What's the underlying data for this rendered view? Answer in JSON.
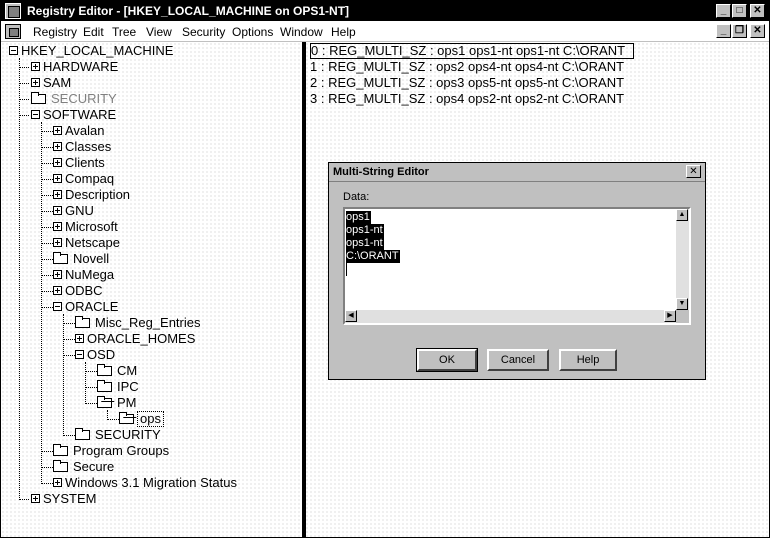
{
  "window": {
    "title": "Registry Editor - [HKEY_LOCAL_MACHINE on OPS1-NT]",
    "controls": {
      "minimize": "_",
      "maximize": "□",
      "close": "✕"
    }
  },
  "menu": {
    "items": [
      "Registry",
      "Edit",
      "Tree",
      "View",
      "Security",
      "Options",
      "Window",
      "Help"
    ],
    "doc_controls": {
      "minimize": "_",
      "restore": "❐",
      "close": "✕"
    }
  },
  "tree": {
    "nodes": [
      {
        "label": "HKEY_LOCAL_MACHINE",
        "expanded": true
      },
      {
        "label": "HARDWARE",
        "expanded": false
      },
      {
        "label": "SAM",
        "expanded": false
      },
      {
        "label": "SECURITY",
        "expanded": false,
        "disabled": true
      },
      {
        "label": "SOFTWARE",
        "expanded": true
      },
      {
        "label": "Avalan",
        "expanded": false
      },
      {
        "label": "Classes",
        "expanded": false
      },
      {
        "label": "Clients",
        "expanded": false
      },
      {
        "label": "Compaq",
        "expanded": false
      },
      {
        "label": "Description",
        "expanded": false
      },
      {
        "label": "GNU",
        "expanded": false
      },
      {
        "label": "Microsoft",
        "expanded": false
      },
      {
        "label": "Netscape",
        "expanded": false
      },
      {
        "label": "Novell",
        "expanded": false
      },
      {
        "label": "NuMega",
        "expanded": false
      },
      {
        "label": "ODBC",
        "expanded": false
      },
      {
        "label": "ORACLE",
        "expanded": true
      },
      {
        "label": "Misc_Reg_Entries",
        "expanded": false
      },
      {
        "label": "ORACLE_HOMES",
        "expanded": false
      },
      {
        "label": "OSD",
        "expanded": true
      },
      {
        "label": "CM",
        "expanded": false
      },
      {
        "label": "IPC",
        "expanded": false
      },
      {
        "label": "PM",
        "expanded": true
      },
      {
        "label": "ops",
        "expanded": true,
        "selected": true
      },
      {
        "label": "SECURITY",
        "expanded": false
      },
      {
        "label": "Program Groups",
        "expanded": false
      },
      {
        "label": "Secure",
        "expanded": false
      },
      {
        "label": "Windows 3.1 Migration Status",
        "expanded": false
      },
      {
        "label": "SYSTEM",
        "expanded": false
      }
    ]
  },
  "values": [
    "0 : REG_MULTI_SZ : ops1 ops1-nt ops1-nt C:\\ORANT",
    "1 : REG_MULTI_SZ : ops2 ops4-nt ops4-nt C:\\ORANT",
    "2 : REG_MULTI_SZ : ops3 ops5-nt ops5-nt C:\\ORANT",
    "3 : REG_MULTI_SZ : ops4 ops2-nt ops2-nt C:\\ORANT"
  ],
  "dialog": {
    "title": "Multi-String Editor",
    "close": "✕",
    "data_label": "Data:",
    "lines": [
      "ops1",
      "ops1-nt",
      "ops1-nt",
      "C:\\ORANT"
    ],
    "ok": "OK",
    "cancel": "Cancel",
    "help": "Help",
    "scroll": {
      "up": "▲",
      "down": "▼",
      "left": "◀",
      "right": "▶"
    }
  }
}
